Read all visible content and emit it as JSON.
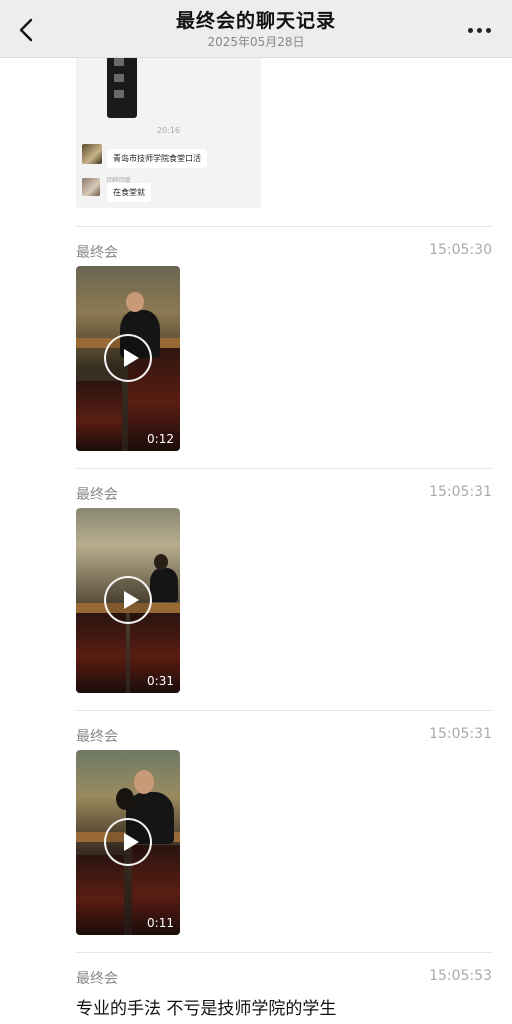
{
  "header": {
    "title": "最终会的聊天记录",
    "date": "2025年05月28日"
  },
  "forwarded": {
    "time": "20:16",
    "messages": [
      {
        "text": "青岛市技师学院食堂口活"
      },
      {
        "name": "回眸回香",
        "text": "在食堂就"
      }
    ]
  },
  "messages": [
    {
      "sender": "最终会",
      "time": "15:05:30",
      "type": "video",
      "duration": "0:12"
    },
    {
      "sender": "最终会",
      "time": "15:05:31",
      "type": "video",
      "duration": "0:31"
    },
    {
      "sender": "最终会",
      "time": "15:05:31",
      "type": "video",
      "duration": "0:11"
    },
    {
      "sender": "最终会",
      "time": "15:05:53",
      "type": "text",
      "text": "专业的手法 不亏是技师学院的学生"
    }
  ],
  "icons": {
    "back": "chevron-left-icon",
    "more": "more-dots-icon",
    "play": "play-icon"
  }
}
